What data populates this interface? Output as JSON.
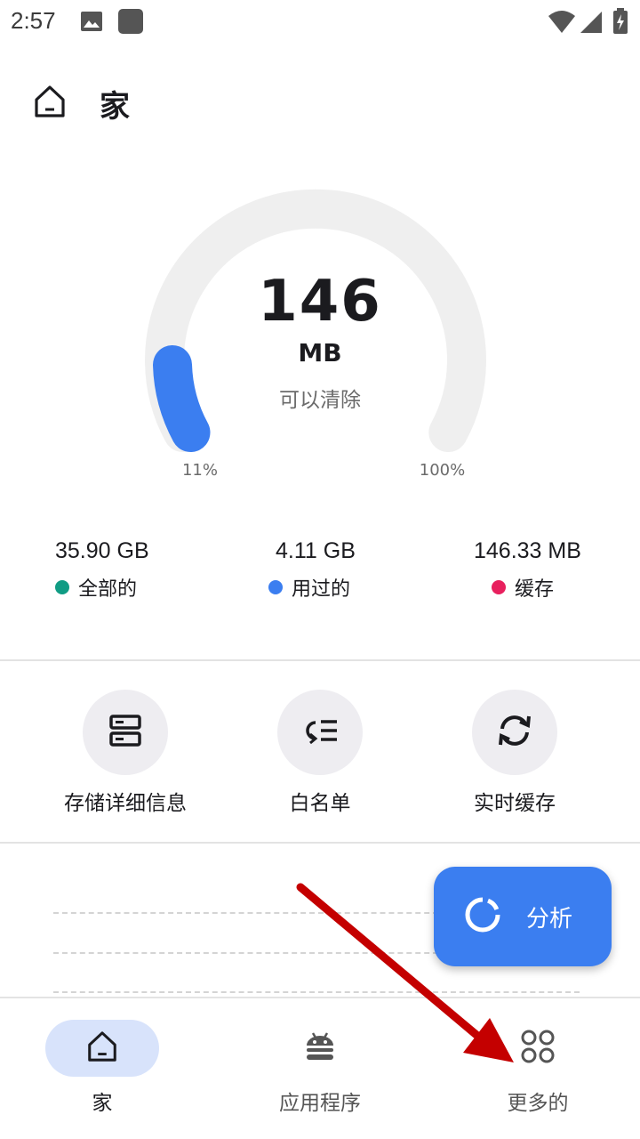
{
  "status_bar": {
    "time": "2:57",
    "icons": [
      "image-icon",
      "square-app-icon",
      "wifi-icon",
      "signal-icon",
      "battery-charging-icon"
    ]
  },
  "header": {
    "title": "家",
    "icon": "home-icon"
  },
  "gauge": {
    "value": "146",
    "unit": "MB",
    "caption": "可以清除",
    "min_label": "11%",
    "max_label": "100%",
    "fill_fraction": 0.11,
    "track_color": "#efefef",
    "fill_color": "#3b7ef0"
  },
  "stats": [
    {
      "value": "35.90 GB",
      "label": "全部的",
      "color": "#109c84"
    },
    {
      "value": "4.11 GB",
      "label": "用过的",
      "color": "#3b7ef0"
    },
    {
      "value": "146.33 MB",
      "label": "缓存",
      "color": "#e8205e"
    }
  ],
  "tools": [
    {
      "label": "存储详细信息",
      "icon": "storage-icon"
    },
    {
      "label": "白名单",
      "icon": "whitelist-icon"
    },
    {
      "label": "实时缓存",
      "icon": "refresh-icon"
    }
  ],
  "fab": {
    "label": "分析",
    "icon": "analyze-ring-icon",
    "color": "#3b7ef0"
  },
  "bottom_nav": [
    {
      "label": "家",
      "icon": "home-icon",
      "active": true
    },
    {
      "label": "应用程序",
      "icon": "android-icon",
      "active": false
    },
    {
      "label": "更多的",
      "icon": "grid-circles-icon",
      "active": false
    }
  ],
  "annotation": {
    "type": "red-arrow",
    "color": "#c40000"
  }
}
